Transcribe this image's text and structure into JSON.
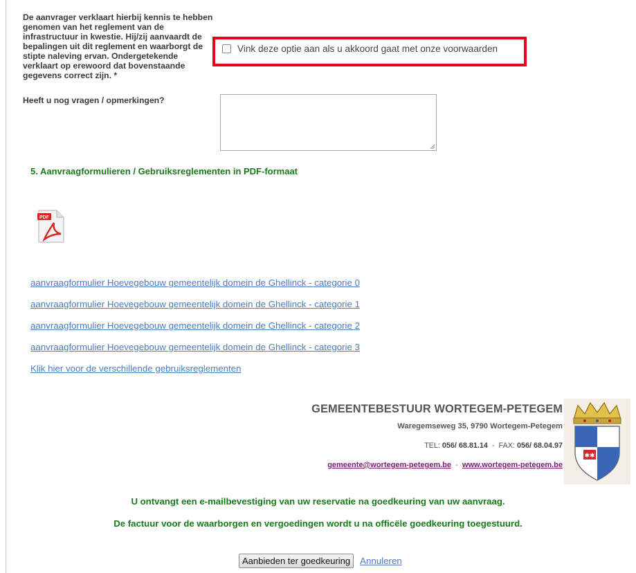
{
  "form": {
    "declaration_text": "De aanvrager verklaart hierbij kennis te hebben genomen van het reglement van de infrastructuur in kwestie. Hij/zij aanvaardt de bepalingen uit dit reglement en waarborgt de stipte naleving ervan. Ondergetekende verklaart op erewoord dat bovenstaande gegevens correct zijn. *",
    "agree_label": "Vink deze optie aan als u akkoord gaat met onze voorwaarden",
    "agree_checked": false,
    "highlight_color": "#e8001c",
    "questions_label": "Heeft u nog vragen / opmerkingen?",
    "questions_value": ""
  },
  "section": {
    "title": "5. Aanvraagformulieren / Gebruiksreglementen in PDF-formaat",
    "pdf_icon": "pdf-file-icon"
  },
  "links": [
    "aanvraagformulier Hoevegebouw gemeentelijk domein de Ghellinck - categorie 0",
    "aanvraagformulier Hoevegebouw gemeentelijk domein de Ghellinck - categorie 1",
    "aanvraagformulier Hoevegebouw gemeentelijk domein de Ghellinck - categorie 2",
    "aanvraagformulier Hoevegebouw gemeentelijk domein de Ghellinck - categorie 3",
    "Klik hier voor de verschillende gebruiksreglementen"
  ],
  "council": {
    "name": "GEMEENTEBESTUUR WORTEGEM-PETEGEM",
    "address": "Waregemseweg 35, 9790 Wortegem-Petegem",
    "tel_label": "TEL:",
    "tel": "056/ 68.81.14",
    "tel_sep": "-",
    "fax_label": "FAX:",
    "fax": "056/ 68.04.97",
    "email": "gemeente@wortegem-petegem.be",
    "web_sep": "-",
    "website": "www.wortegem-petegem.be",
    "crest_icon": "municipal-crest-icon"
  },
  "notices": {
    "confirmation": "U ontvangt een e-mailbevestiging van uw reservatie na goedkeuring van uw aanvraag.",
    "invoice": "De factuur voor de waarborgen en vergoedingen wordt u na officële goedkeuring toegestuurd."
  },
  "actions": {
    "submit_label": "Aanbieden ter goedkeuring",
    "cancel_label": "Annuleren"
  },
  "colors": {
    "section_green": "#1a7a1a",
    "link_blue": "#4a7cbf",
    "email_purple": "#7a1e6d"
  }
}
